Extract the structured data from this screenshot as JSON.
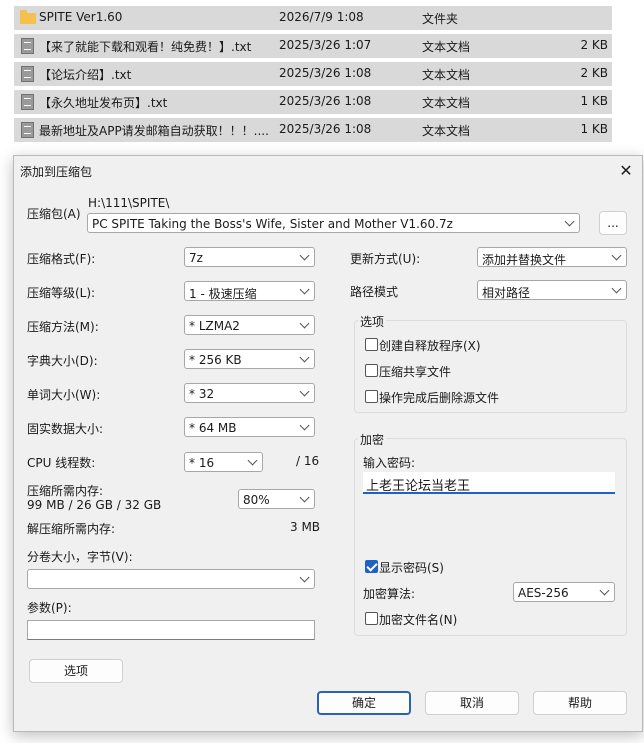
{
  "files": [
    {
      "name": "SPITE Ver1.60",
      "date": "2026/7/9 1:08",
      "type": "文件夹",
      "size": "",
      "icon": "folder-icon"
    },
    {
      "name": "【来了就能下载和观看！纯免费！】.txt",
      "date": "2025/3/26 1:07",
      "type": "文本文档",
      "size": "2 KB",
      "icon": "text-file-icon"
    },
    {
      "name": "【论坛介绍】.txt",
      "date": "2025/3/26 1:08",
      "type": "文本文档",
      "size": "2 KB",
      "icon": "text-file-icon"
    },
    {
      "name": "【永久地址发布页】.txt",
      "date": "2025/3/26 1:08",
      "type": "文本文档",
      "size": "1 KB",
      "icon": "text-file-icon"
    },
    {
      "name": "最新地址及APP请发邮箱自动获取！！！....",
      "date": "2025/3/26 1:08",
      "type": "文本文档",
      "size": "1 KB",
      "icon": "text-file-icon"
    }
  ],
  "dialog": {
    "title": "添加到压缩包",
    "archive_label": "压缩包(A)",
    "archive_path": "H:\\111\\SPITE\\",
    "archive_name": "PC SPITE Taking the Boss's Wife, Sister and Mother V1.60.7z",
    "browse_label": "...",
    "format_label": "压缩格式(F):",
    "format_value": "7z",
    "level_label": "压缩等级(L):",
    "level_value": "1 - 极速压缩",
    "method_label": "压缩方法(M):",
    "method_value": "* LZMA2",
    "dict_label": "字典大小(D):",
    "dict_value": "* 256 KB",
    "word_label": "单词大小(W):",
    "word_value": "* 32",
    "solid_label": "固实数据大小:",
    "solid_value": "* 64 MB",
    "threads_label": "CPU 线程数:",
    "threads_value": "* 16",
    "threads_total": "/ 16",
    "mem_label": "压缩所需内存:",
    "mem_detail": "99 MB / 26 GB / 32 GB",
    "mem_percent": "80%",
    "decomp_label": "解压缩所需内存:",
    "decomp_value": "3 MB",
    "split_label": "分卷大小，字节(V):",
    "split_value": "",
    "params_label": "参数(P):",
    "params_value": "",
    "options_button": "选项",
    "update_label": "更新方式(U):",
    "update_value": "添加并替换文件",
    "path_label": "路径模式",
    "path_value": "相对路径",
    "options_group": "选项",
    "opt_sfx": "创建自释放程序(X)",
    "opt_sfx_checked": false,
    "opt_shared": "压缩共享文件",
    "opt_shared_checked": false,
    "opt_delete": "操作完成后删除源文件",
    "opt_delete_checked": false,
    "encrypt_group": "加密",
    "pw_label": "输入密码:",
    "pw_value": "上老王论坛当老王",
    "show_pw": "显示密码(S)",
    "show_pw_checked": true,
    "algo_label": "加密算法:",
    "algo_value": "AES-256",
    "enc_names": "加密文件名(N)",
    "enc_names_checked": false,
    "ok": "确定",
    "cancel": "取消",
    "help": "帮助"
  },
  "colors": {
    "accent": "#1f61c4",
    "folder": "#f4c04e",
    "file_row_bg": "#d9d9d9",
    "dialog_bg": "#f0f0f0"
  }
}
